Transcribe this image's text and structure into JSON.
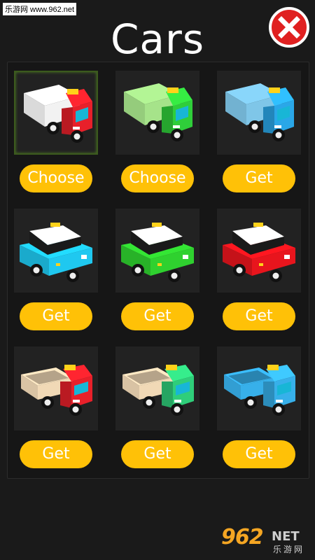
{
  "watermark_top": "乐游网 www.962.net",
  "title": "Cars",
  "colors": {
    "button": "#ffc107",
    "close": "#e02020",
    "selected_border": "#3c5a1e"
  },
  "cars": [
    {
      "kind": "truck",
      "body": "#f2f2f2",
      "cab": "#e8202a",
      "button": "Choose",
      "selected": true,
      "icon": "white-red-box-truck-icon"
    },
    {
      "kind": "truck",
      "body": "#a6e38a",
      "cab": "#2fce3a",
      "button": "Choose",
      "selected": false,
      "icon": "green-box-truck-icon"
    },
    {
      "kind": "truck",
      "body": "#7fc6e8",
      "cab": "#2aa7e8",
      "button": "Get",
      "selected": false,
      "icon": "blue-box-truck-icon"
    },
    {
      "kind": "taxi",
      "body": "#1fc8f0",
      "cab": "#1fc8f0",
      "button": "Get",
      "selected": false,
      "icon": "blue-taxi-icon"
    },
    {
      "kind": "taxi",
      "body": "#2fd12f",
      "cab": "#2fd12f",
      "button": "Get",
      "selected": false,
      "icon": "green-taxi-icon"
    },
    {
      "kind": "taxi",
      "body": "#e8151d",
      "cab": "#e8151d",
      "button": "Get",
      "selected": false,
      "icon": "red-taxi-icon"
    },
    {
      "kind": "pickup",
      "body": "#f1d9b6",
      "cab": "#e8202a",
      "button": "Get",
      "selected": false,
      "icon": "red-pickup-icon"
    },
    {
      "kind": "pickup",
      "body": "#f1d9b6",
      "cab": "#2fce7a",
      "button": "Get",
      "selected": false,
      "icon": "green-pickup-icon"
    },
    {
      "kind": "pickup",
      "body": "#37b0ea",
      "cab": "#37b0ea",
      "button": "Get",
      "selected": false,
      "icon": "blue-pickup-icon"
    }
  ],
  "logo": {
    "number": "962",
    "suffix": "NET",
    "chinese": "乐游网"
  }
}
